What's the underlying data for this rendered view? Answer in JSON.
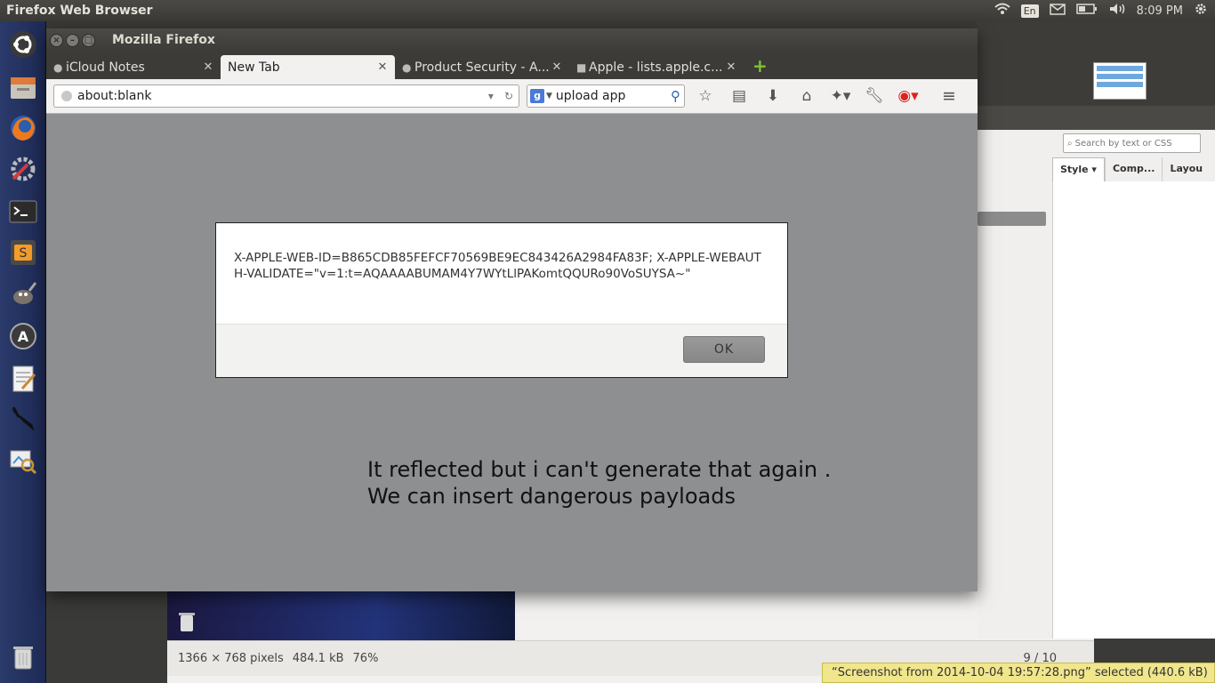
{
  "top_panel": {
    "app_title": "Firefox Web Browser",
    "language": "En",
    "time": "8:09 PM"
  },
  "launcher": {
    "items": [
      "Dash Home",
      "Files",
      "Firefox",
      "System Settings",
      "Terminal",
      "Sublime Text",
      "GIMP",
      "Ubuntu Software Center",
      "Text Editor",
      "Burp",
      "Image Viewer",
      "Trash"
    ]
  },
  "firefox": {
    "window_title": "Mozilla Firefox",
    "tabs": [
      {
        "label": "iCloud Notes"
      },
      {
        "label": "New Tab"
      },
      {
        "label": "Product Security - A..."
      },
      {
        "label": "Apple - lists.apple.c..."
      }
    ],
    "url": "about:blank",
    "search_query": "upload app",
    "search_engine_letter": "g"
  },
  "alert": {
    "message": "X-APPLE-WEB-ID=B865CDB85FEFCF70569BE9EC843426A2984FA83F; X-APPLE-WEBAUTH-VALIDATE=\"v=1:t=AQAAAABUMAM4Y7WYtLlPAKomtQQURo90VoSUYSA~\"",
    "ok_label": "OK"
  },
  "annotation": {
    "line1": "It reflected but i can't generate that again .",
    "line2": "We can insert dangerous payloads"
  },
  "background": {
    "devtools_search_placeholder": "Search by text or CSS",
    "devtools_tabs": [
      "Style",
      "Comp...",
      "Layou"
    ],
    "image_info": "1366 × 768 pixels",
    "image_size": "484.1 kB",
    "zoom": "76%",
    "page_counter": "9 / 10",
    "notification": "“Screenshot from 2014-10-04 19:57:28.png” selected  (440.6 kB)"
  }
}
